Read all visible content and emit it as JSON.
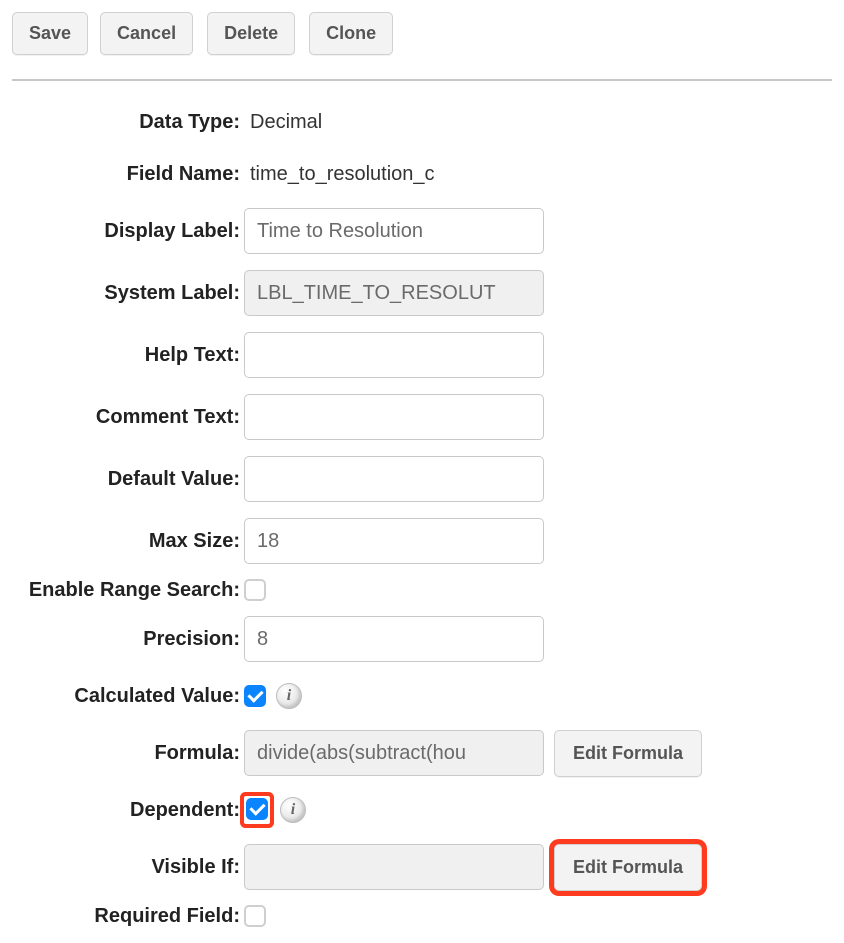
{
  "toolbar": {
    "save": "Save",
    "cancel": "Cancel",
    "delete": "Delete",
    "clone": "Clone"
  },
  "labels": {
    "data_type": "Data Type:",
    "field_name": "Field Name:",
    "display_label": "Display Label:",
    "system_label": "System Label:",
    "help_text": "Help Text:",
    "comment_text": "Comment Text:",
    "default_value": "Default Value:",
    "max_size": "Max Size:",
    "range_search": "Enable Range Search:",
    "precision": "Precision:",
    "calculated": "Calculated Value:",
    "formula": "Formula:",
    "dependent": "Dependent:",
    "visible_if": "Visible If:",
    "required_field": "Required Field:"
  },
  "values": {
    "data_type": "Decimal",
    "field_name": "time_to_resolution_c",
    "display_label": "Time to Resolution",
    "system_label": "LBL_TIME_TO_RESOLUT",
    "help_text": "",
    "comment_text": "",
    "default_value": "",
    "max_size": "18",
    "precision": "8",
    "formula": "divide(abs(subtract(hou",
    "visible_if": ""
  },
  "buttons": {
    "edit_formula": "Edit Formula"
  },
  "checkboxes": {
    "range_search": false,
    "calculated": true,
    "dependent": true,
    "required": false
  },
  "info_glyph": "i"
}
